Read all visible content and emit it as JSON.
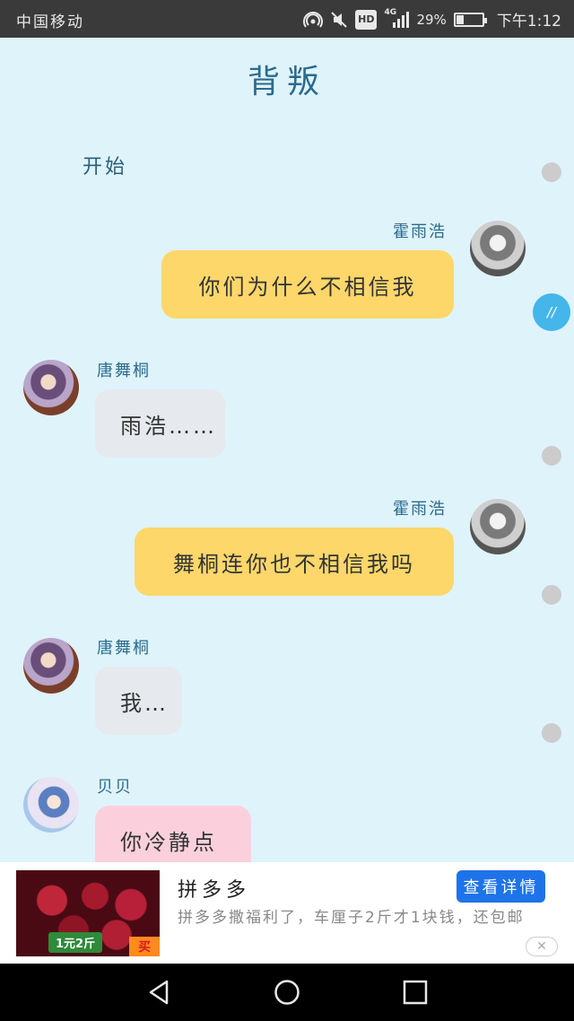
{
  "status_bar": {
    "carrier": "中国移动",
    "network": "4G",
    "hd": "HD",
    "battery_percent": "29%",
    "battery_level": 0.29,
    "time": "下午1:12"
  },
  "title": "背叛",
  "start_label": "开始",
  "edit_button": "//",
  "messages": [
    {
      "sender": "霍雨浩",
      "text": "你们为什么不相信我",
      "side": "right",
      "avatar": "huo"
    },
    {
      "sender": "唐舞桐",
      "text": "雨浩……",
      "side": "left",
      "avatar": "tang"
    },
    {
      "sender": "霍雨浩",
      "text": "舞桐连你也不相信我吗",
      "side": "right",
      "avatar": "huo"
    },
    {
      "sender": "唐舞桐",
      "text": "我…",
      "side": "left",
      "avatar": "tang"
    },
    {
      "sender": "贝贝",
      "text": "你冷静点",
      "side": "left",
      "avatar": "bei"
    }
  ],
  "ad": {
    "title": "拼多多",
    "description": "拼多多撒福利了，车厘子2斤才1块钱，还包邮",
    "button": "查看详情",
    "image_price": "1元2斤",
    "image_buy": "买",
    "close": "✕"
  },
  "colors": {
    "background": "#dff3fb",
    "bubble_self": "#fdd76a",
    "bubble_other": "#e6e9ee",
    "bubble_pink": "#fbd0dc",
    "accent": "#44b6ea",
    "ad_button": "#1e73e8"
  }
}
